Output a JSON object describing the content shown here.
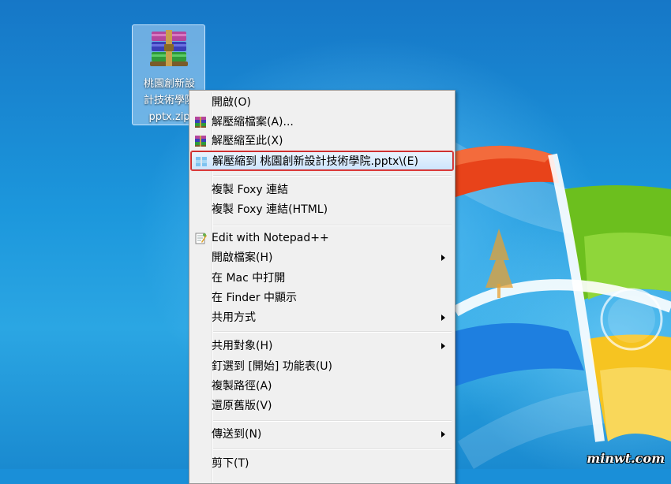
{
  "desktop": {
    "file_icon": {
      "icon": "winrar-archive-icon",
      "label": "桃園創新設\n計技術學院\npptx.zip"
    }
  },
  "context_menu": {
    "items": [
      {
        "label": "開啟(O)",
        "icon": null,
        "submenu": false
      },
      {
        "label": "解壓縮檔案(A)...",
        "icon": "winrar-icon",
        "submenu": false
      },
      {
        "label": "解壓縮至此(X)",
        "icon": "winrar-icon",
        "submenu": false
      },
      {
        "label": "解壓縮到 桃園創新設計技術學院.pptx\\(E)",
        "icon": "winrar-extract-icon",
        "submenu": false,
        "highlighted": true
      },
      {
        "separator": true
      },
      {
        "label": "複製 Foxy 連結",
        "icon": null,
        "submenu": false
      },
      {
        "label": "複製 Foxy 連結(HTML)",
        "icon": null,
        "submenu": false
      },
      {
        "separator": true
      },
      {
        "label": "Edit with Notepad++",
        "icon": "notepad-plus-icon",
        "submenu": false
      },
      {
        "label": "開啟檔案(H)",
        "icon": null,
        "submenu": true
      },
      {
        "label": "在 Mac 中打開",
        "icon": null,
        "submenu": false
      },
      {
        "label": "在 Finder 中顯示",
        "icon": null,
        "submenu": false
      },
      {
        "label": "共用方式",
        "icon": null,
        "submenu": true
      },
      {
        "separator": true
      },
      {
        "label": "共用對象(H)",
        "icon": null,
        "submenu": true
      },
      {
        "label": "釘選到 [開始] 功能表(U)",
        "icon": null,
        "submenu": false
      },
      {
        "label": "複製路徑(A)",
        "icon": null,
        "submenu": false
      },
      {
        "label": "還原舊版(V)",
        "icon": null,
        "submenu": false
      },
      {
        "separator": true
      },
      {
        "label": "傳送到(N)",
        "icon": null,
        "submenu": true
      },
      {
        "separator": true
      },
      {
        "label": "剪下(T)",
        "icon": null,
        "submenu": false
      }
    ]
  },
  "watermark": "minwt.com",
  "colors": {
    "highlight_border": "#c62828",
    "menu_background": "#f0f0f0",
    "desktop_blue": "#1a8fd8"
  }
}
